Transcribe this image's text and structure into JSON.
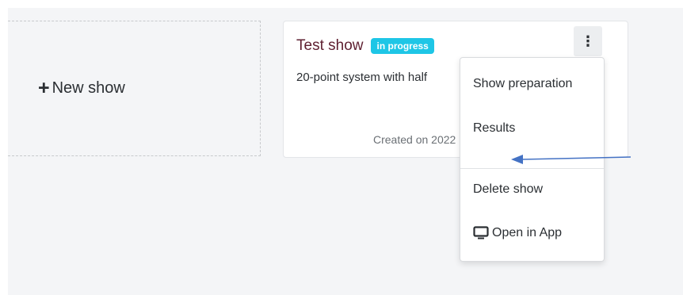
{
  "new_show": {
    "label": "New show"
  },
  "show_card": {
    "title": "Test show",
    "badge": "in progress",
    "description": "20-point system with half",
    "created": "Created on 2022"
  },
  "menu": {
    "items": [
      {
        "label": "Show preparation"
      },
      {
        "label": "Results"
      },
      {
        "label": "Delete show"
      },
      {
        "label": "Open in App"
      }
    ]
  },
  "colors": {
    "badge_bg": "#1ec6e6",
    "title": "#5e1f30",
    "arrow": "#4472c4"
  },
  "icons": {
    "plus": "plus-icon",
    "kebab": "vertical-ellipsis-icon",
    "monitor": "monitor-icon"
  }
}
